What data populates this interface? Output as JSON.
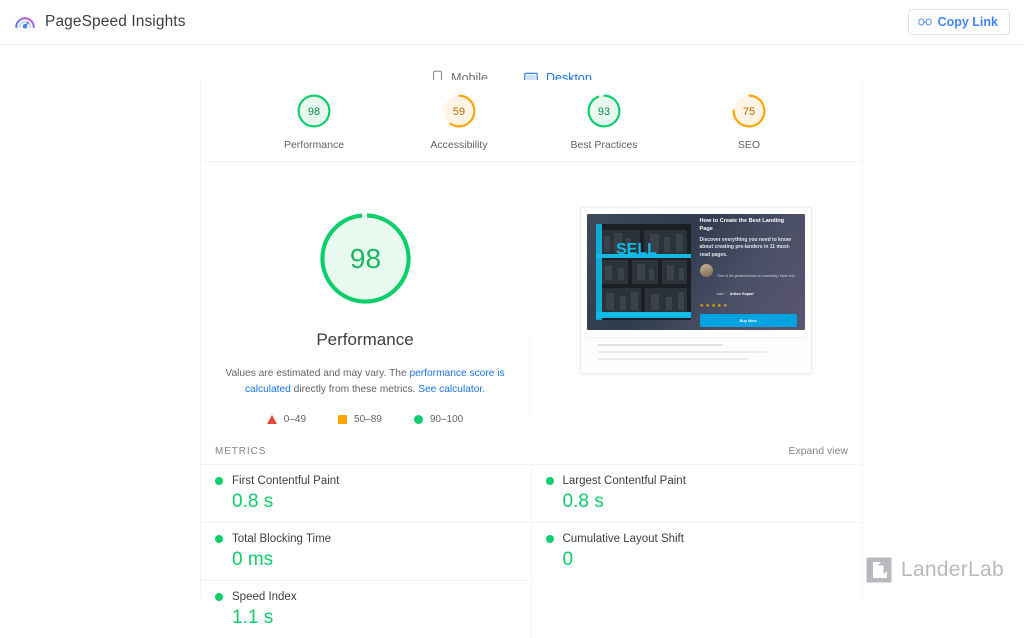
{
  "header": {
    "title": "PageSpeed Insights",
    "logo_icon": "pagespeed-logo-icon",
    "copy_link": {
      "label": "Copy Link",
      "icon": "link-icon"
    }
  },
  "tabs": [
    {
      "label": "Mobile",
      "icon": "mobile-icon",
      "active": false
    },
    {
      "label": "Desktop",
      "icon": "desktop-icon",
      "active": true
    }
  ],
  "category_scores": [
    {
      "label": "Performance",
      "score": "98",
      "color": "#0cce6b",
      "fill": "#e8f8ef"
    },
    {
      "label": "Accessibility",
      "score": "59",
      "color": "#ffa400",
      "fill": "#fff4e5"
    },
    {
      "label": "Best Practices",
      "score": "93",
      "color": "#0cce6b",
      "fill": "#e8f8ef"
    },
    {
      "label": "SEO",
      "score": "75",
      "color": "#ffa400",
      "fill": "#fff4e5"
    }
  ],
  "performance": {
    "score": "98",
    "label": "Performance",
    "color": "#0cce6b",
    "fill": "#e9f9f0",
    "disclaimer_part1": "Values are estimated and may vary. The ",
    "disclaimer_link1": "performance score is calculated",
    "disclaimer_part2": " directly from these metrics. ",
    "disclaimer_link2": "See calculator.",
    "legend": [
      {
        "icon": "triangle-icon",
        "range": "0–49",
        "color": "#e8453c"
      },
      {
        "icon": "square-icon",
        "range": "50–89",
        "color": "#ffa400"
      },
      {
        "icon": "circle-icon",
        "range": "90–100",
        "color": "#0cce6b"
      }
    ]
  },
  "screenshot_preview": {
    "heading": "How to Create the Best Landing Page",
    "body": "Discover everything you need to know about creating pre-landers in 11 must-read pages.",
    "quote": "\"One of the greatest books on marketing I have ever read.\"",
    "author": "Arthur Gopart",
    "stars": "★★★★★",
    "cta_label": "Buy Now"
  },
  "metrics": {
    "title": "METRICS",
    "expand_view": "Expand view",
    "left": [
      {
        "name": "First Contentful Paint",
        "value": "0.8 s",
        "color": "#0cce6b"
      },
      {
        "name": "Total Blocking Time",
        "value": "0 ms",
        "color": "#0cce6b"
      },
      {
        "name": "Speed Index",
        "value": "1.1 s",
        "color": "#0cce6b"
      }
    ],
    "right": [
      {
        "name": "Largest Contentful Paint",
        "value": "0.8 s",
        "color": "#0cce6b"
      },
      {
        "name": "Cumulative Layout Shift",
        "value": "0",
        "color": "#0cce6b"
      }
    ]
  },
  "watermark": {
    "text": "LanderLab",
    "icon": "landerlab-logo-icon"
  }
}
